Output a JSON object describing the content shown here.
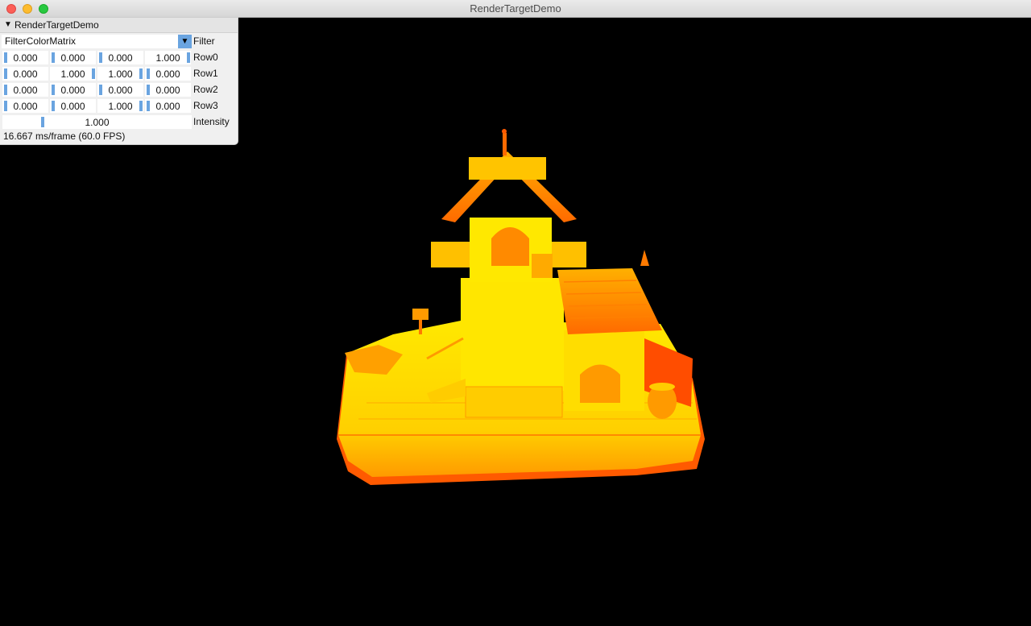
{
  "window": {
    "title": "RenderTargetDemo"
  },
  "panel": {
    "title": "RenderTargetDemo",
    "filter": {
      "value": "FilterColorMatrix",
      "label": "Filter"
    },
    "rows": [
      {
        "label": "Row0",
        "values": [
          "0.000",
          "0.000",
          "0.000",
          "1.000"
        ]
      },
      {
        "label": "Row1",
        "values": [
          "0.000",
          "1.000",
          "1.000",
          "0.000"
        ]
      },
      {
        "label": "Row2",
        "values": [
          "0.000",
          "0.000",
          "0.000",
          "0.000"
        ]
      },
      {
        "label": "Row3",
        "values": [
          "0.000",
          "0.000",
          "1.000",
          "0.000"
        ]
      }
    ],
    "intensity": {
      "value": "1.000",
      "label": "Intensity"
    },
    "status": "16.667 ms/frame (60.0 FPS)"
  },
  "colors": {
    "accent": "#6aa4e0",
    "scene_base": "#ffd400",
    "scene_shadow": "#ff5a00"
  },
  "icons": {
    "collapse": "triangle-down-icon",
    "dropdown": "chevron-down-icon"
  }
}
